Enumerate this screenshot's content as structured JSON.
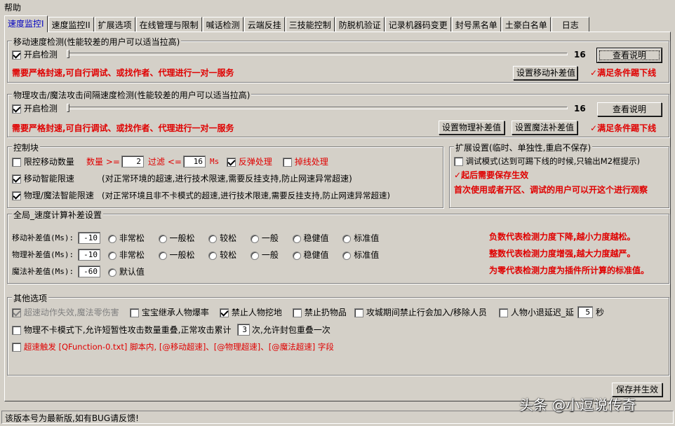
{
  "menu": {
    "help": "帮助"
  },
  "tabs": [
    "速度监控I",
    "速度监控II",
    "扩展选项",
    "在线管理与限制",
    "喊话检测",
    "云端反挂",
    "三技能控制",
    "防脱机验证",
    "记录机器码变更",
    "封号黑名单",
    "土豪白名单",
    "日志"
  ],
  "move_speed": {
    "title": "移动速度检测(性能较差的用户可以适当拉高)",
    "enable_label": "开启检测",
    "slider_value": "16",
    "help_button": "查看说明",
    "warning": "需要严格封速,可自行调试、或找作者、代理进行一对一服务",
    "set_button": "设置移动补差值",
    "kick_label": "满足条件踢下线"
  },
  "attack_speed": {
    "title": "物理攻击/魔法攻击间隔速度检测(性能较差的用户可以适当拉高)",
    "enable_label": "开启检测",
    "slider_value": "16",
    "help_button": "查看说明",
    "warning": "需要严格封速,可自行调试、或找作者、代理进行一对一服务",
    "set_phys_button": "设置物理补差值",
    "set_magic_button": "设置魔法补差值",
    "kick_label": "满足条件踢下线"
  },
  "control": {
    "title": "控制块",
    "limit_move_label": "限控移动数量",
    "count_label": "数量 >=",
    "count_value": "2",
    "filter_label": "过滤 <=",
    "filter_value": "16",
    "ms_label": "Ms",
    "rebound_label": "反弹处理",
    "disconnect_label": "掉线处理",
    "smart_move_label": "移动智能限速",
    "smart_move_desc": "(对正常环境的超速,进行技术限速,需要反挂支持,防止网速异常超速)",
    "smart_attack_label": "物理/魔法智能限速",
    "smart_attack_desc": "(对正常环境且非不卡模式的超速,进行技术限速,需要反挂支持,防止网速异常超速)"
  },
  "extension": {
    "title": "扩展设置(临时、单独性,重启不保存)",
    "debug_label": "调试模式(达到可踢下线的时候,只输出M2框提示)",
    "note1": "起后需要保存生效",
    "note2": "首次使用或者开区、调试的用户可以开这个进行观察"
  },
  "global": {
    "title": "全局_速度计算补差设置",
    "move_label": "移动补差值(Ms):",
    "move_value": "-10",
    "phys_label": "物理补差值(Ms):",
    "phys_value": "-10",
    "magic_label": "魔法补差值(Ms):",
    "magic_value": "-60",
    "options": [
      "非常松",
      "一般松",
      "较松",
      "一般",
      "稳健值",
      "标准值"
    ],
    "magic_option": "默认值",
    "note1": "负数代表检测力度下降,越小力度越松。",
    "note2": "整数代表检测力度增强,越大力度越严。",
    "note3": "为零代表检测力度为插件所计算的标准值。"
  },
  "other": {
    "title": "其他选项",
    "opt1": "超速动作失效,魔法零伤害",
    "opt2": "宝宝继承人物爆率",
    "opt3": "禁止人物挖地",
    "opt4": "禁止扔物品",
    "opt5": "攻城期间禁止行会加入/移除人员",
    "opt6": "人物小退延迟_延",
    "opt6_value": "5",
    "opt6_unit": "秒",
    "opt7_a": "物理不卡模式下,允许短暂性攻击数量重叠,正常攻击累计",
    "opt7_value": "3",
    "opt7_b": "次,允许封包重叠一次",
    "opt8": "超速触发 [QFunction-0.txt] 脚本内, [@移动超速]、[@物理超速]、[@魔法超速] 字段"
  },
  "save_button": "保存并生效",
  "status": "该版本号为最新版,如有BUG请反馈!",
  "watermark": "头条 @小逗说传奇",
  "colors": {
    "window": "#d4d0c8",
    "active_tab": "#0000c0",
    "warning": "#e00000"
  }
}
